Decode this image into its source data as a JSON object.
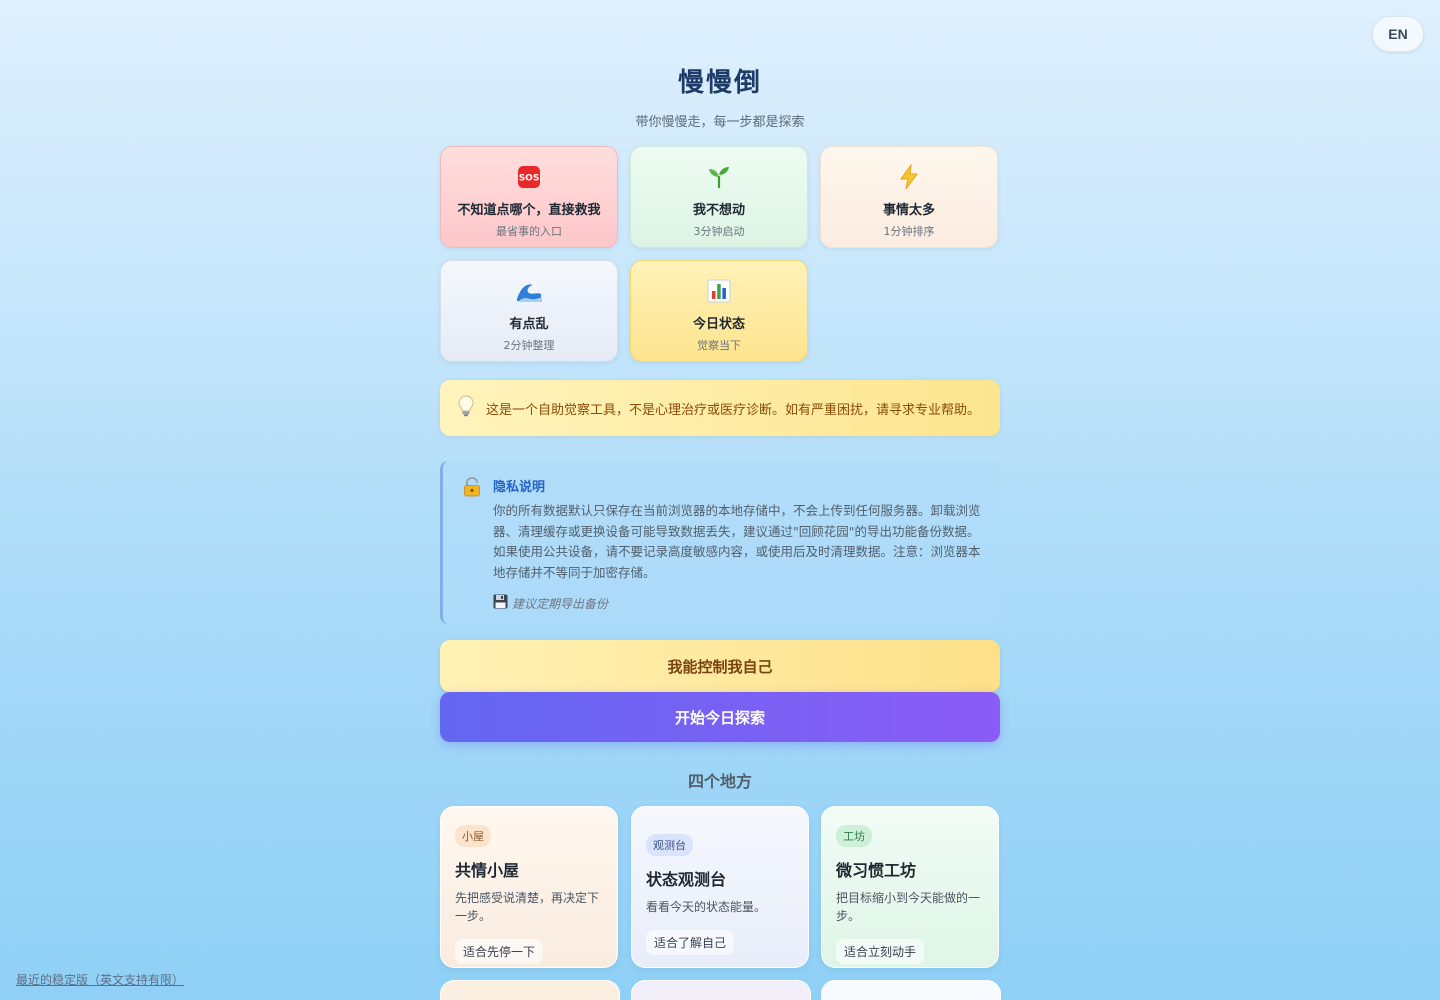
{
  "lang_toggle": "EN",
  "header": {
    "title": "慢慢倒",
    "subtitle": "带你慢慢走，每一步都是探索"
  },
  "entries": [
    {
      "icon": "sos-icon",
      "title": "不知道点哪个，直接救我",
      "subtitle": "最省事的入口"
    },
    {
      "icon": "seedling-icon",
      "title": "我不想动",
      "subtitle": "3分钟启动"
    },
    {
      "icon": "lightning-icon",
      "title": "事情太多",
      "subtitle": "1分钟排序"
    },
    {
      "icon": "wave-icon",
      "title": "有点乱",
      "subtitle": "2分钟整理"
    },
    {
      "icon": "bar-chart-icon",
      "title": "今日状态",
      "subtitle": "觉察当下"
    }
  ],
  "notice": {
    "icon": "lightbulb-icon",
    "text": "这是一个自助觉察工具，不是心理治疗或医疗诊断。如有严重困扰，请寻求专业帮助。"
  },
  "privacy": {
    "icon": "lock-icon",
    "title": "隐私说明",
    "body": "你的所有数据默认只保存在当前浏览器的本地存储中，不会上传到任何服务器。卸载浏览器、清理缓存或更换设备可能导致数据丢失，建议通过\"回顾花园\"的导出功能备份数据。如果使用公共设备，请不要记录高度敏感内容，或使用后及时清理数据。注意：浏览器本地存储并不等同于加密存储。",
    "tip_icon": "floppy-disk-icon",
    "tip": "建议定期导出备份"
  },
  "actions": {
    "control": "我能控制我自己",
    "start": "开始今日探索"
  },
  "places_title": "四个地方",
  "places": [
    {
      "tag": "小屋",
      "title": "共情小屋",
      "desc": "先把感受说清楚，再决定下一步。",
      "fit": "适合先停一下"
    },
    {
      "tag": "观测台",
      "title": "状态观测台",
      "desc": "看看今天的状态能量。",
      "fit": "适合了解自己"
    },
    {
      "tag": "工坊",
      "title": "微习惯工坊",
      "desc": "把目标缩小到今天能做的一步。",
      "fit": "适合立刻动手"
    }
  ],
  "footer_link": "最近的稳定版（英文支持有限）"
}
